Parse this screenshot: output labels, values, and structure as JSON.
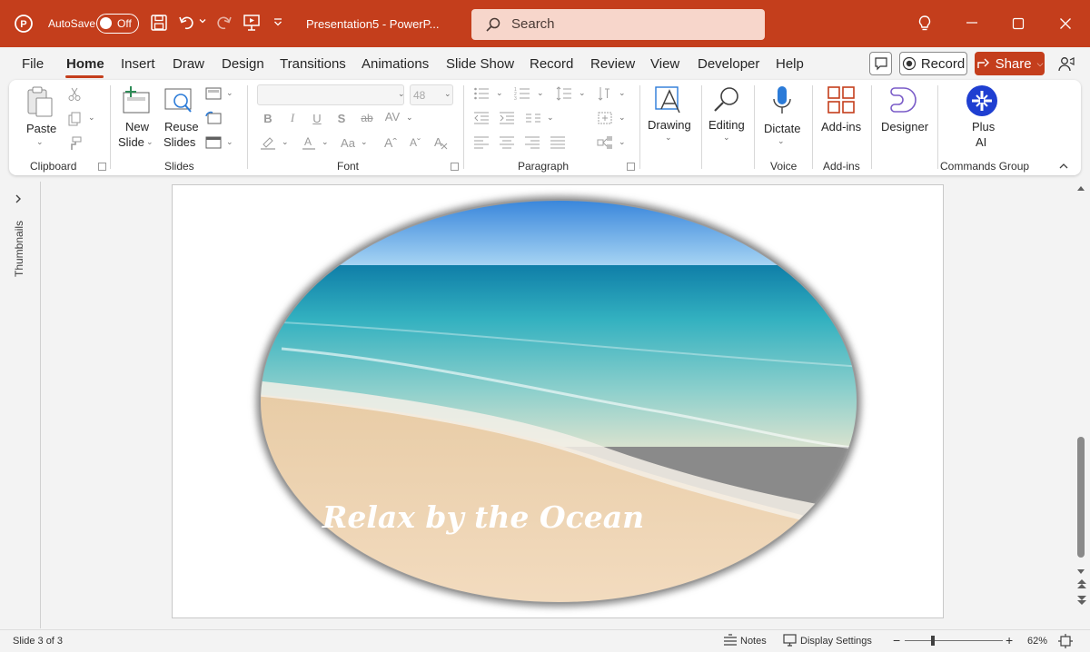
{
  "titlebar": {
    "autosave_label": "AutoSave",
    "autosave_state": "Off",
    "doc_title": "Presentation5  -  PowerP...",
    "search_placeholder": "Search",
    "accent": "#c43e1c"
  },
  "tabs": [
    {
      "label": "File"
    },
    {
      "label": "Home",
      "active": true
    },
    {
      "label": "Insert"
    },
    {
      "label": "Draw"
    },
    {
      "label": "Design"
    },
    {
      "label": "Transitions"
    },
    {
      "label": "Animations"
    },
    {
      "label": "Slide Show"
    },
    {
      "label": "Record"
    },
    {
      "label": "Review"
    },
    {
      "label": "View"
    },
    {
      "label": "Developer"
    },
    {
      "label": "Help"
    }
  ],
  "tab_actions": {
    "record_label": "Record",
    "share_label": "Share"
  },
  "ribbon": {
    "clipboard": {
      "paste": "Paste",
      "group": "Clipboard"
    },
    "slides": {
      "new_1": "New",
      "new_2": "Slide",
      "reuse_1": "Reuse",
      "reuse_2": "Slides",
      "group": "Slides"
    },
    "font": {
      "size": "48",
      "group": "Font"
    },
    "paragraph": {
      "group": "Paragraph"
    },
    "drawing": {
      "label": "Drawing"
    },
    "editing": {
      "label": "Editing"
    },
    "voice": {
      "dictate": "Dictate",
      "group": "Voice"
    },
    "addins": {
      "label": "Add-ins",
      "group": "Add-ins"
    },
    "designer": {
      "label": "Designer"
    },
    "plusai": {
      "label_1": "Plus",
      "label_2": "AI",
      "group": "Commands Group"
    }
  },
  "side": {
    "thumbnails": "Thumbnails"
  },
  "slide": {
    "caption": "Relax by the Ocean"
  },
  "status": {
    "slide_info": "Slide 3 of 3",
    "notes": "Notes",
    "display_settings": "Display Settings",
    "zoom": "62%",
    "zoom_level": 0.62
  }
}
